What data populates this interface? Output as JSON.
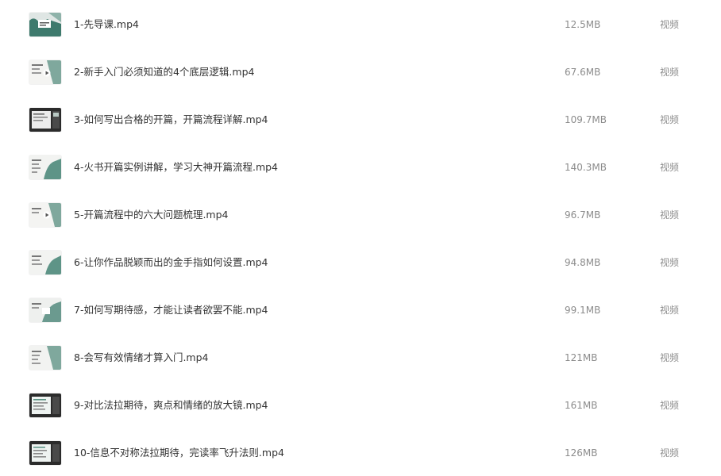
{
  "files": [
    {
      "name": "1-先导课.mp4",
      "size": "12.5MB",
      "type": "视频",
      "thumbnail": "video-thumbnail-icon"
    },
    {
      "name": "2-新手入门必须知道的4个底层逻辑.mp4",
      "size": "67.6MB",
      "type": "视频",
      "thumbnail": "video-thumbnail-icon"
    },
    {
      "name": "3-如何写出合格的开篇，开篇流程详解.mp4",
      "size": "109.7MB",
      "type": "视频",
      "thumbnail": "video-thumbnail-icon"
    },
    {
      "name": "4-火书开篇实例讲解，学习大神开篇流程.mp4",
      "size": "140.3MB",
      "type": "视频",
      "thumbnail": "video-thumbnail-icon"
    },
    {
      "name": "5-开篇流程中的六大问题梳理.mp4",
      "size": "96.7MB",
      "type": "视频",
      "thumbnail": "video-thumbnail-icon"
    },
    {
      "name": "6-让你作品脱颖而出的金手指如何设置.mp4",
      "size": "94.8MB",
      "type": "视频",
      "thumbnail": "video-thumbnail-icon"
    },
    {
      "name": "7-如何写期待感，才能让读者欲罢不能.mp4",
      "size": "99.1MB",
      "type": "视频",
      "thumbnail": "video-thumbnail-icon"
    },
    {
      "name": "8-会写有效情绪才算入门.mp4",
      "size": "121MB",
      "type": "视频",
      "thumbnail": "video-thumbnail-icon"
    },
    {
      "name": "9-对比法拉期待，爽点和情绪的放大镜.mp4",
      "size": "161MB",
      "type": "视频",
      "thumbnail": "video-thumbnail-icon"
    },
    {
      "name": "10-信息不对称法拉期待，完读率飞升法则.mp4",
      "size": "126MB",
      "type": "视频",
      "thumbnail": "video-thumbnail-icon"
    }
  ]
}
